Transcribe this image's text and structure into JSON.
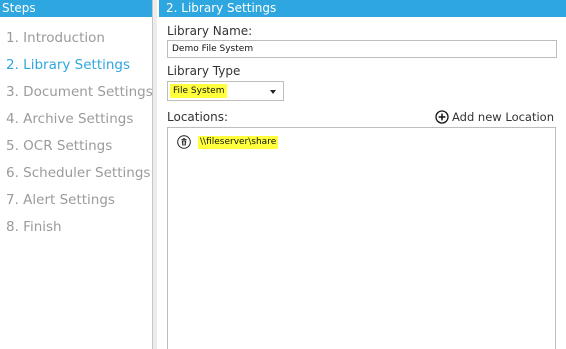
{
  "steps": {
    "header": "Steps",
    "items": [
      {
        "label": "1. Introduction",
        "active": false
      },
      {
        "label": "2. Library Settings",
        "active": true
      },
      {
        "label": "3. Document Settings",
        "active": false
      },
      {
        "label": "4. Archive Settings",
        "active": false
      },
      {
        "label": "5. OCR Settings",
        "active": false
      },
      {
        "label": "6. Scheduler Settings",
        "active": false
      },
      {
        "label": "7. Alert Settings",
        "active": false
      },
      {
        "label": "8. Finish",
        "active": false
      }
    ]
  },
  "settings": {
    "header": "2. Library Settings",
    "library_name_label": "Library Name:",
    "library_name_value": "Demo File System",
    "library_type_label": "Library Type",
    "library_type_value": "File System",
    "locations_label": "Locations:",
    "add_location_label": "Add new Location",
    "locations": [
      "\\\\fileserver\\share"
    ]
  },
  "colors": {
    "accent": "#2ea7e0",
    "highlight": "#ffff3b",
    "inactive_text": "#9b9b9b"
  },
  "icons": {
    "add": "plus-circle-icon",
    "remove": "trash-icon",
    "dropdown": "chevron-down-icon"
  }
}
